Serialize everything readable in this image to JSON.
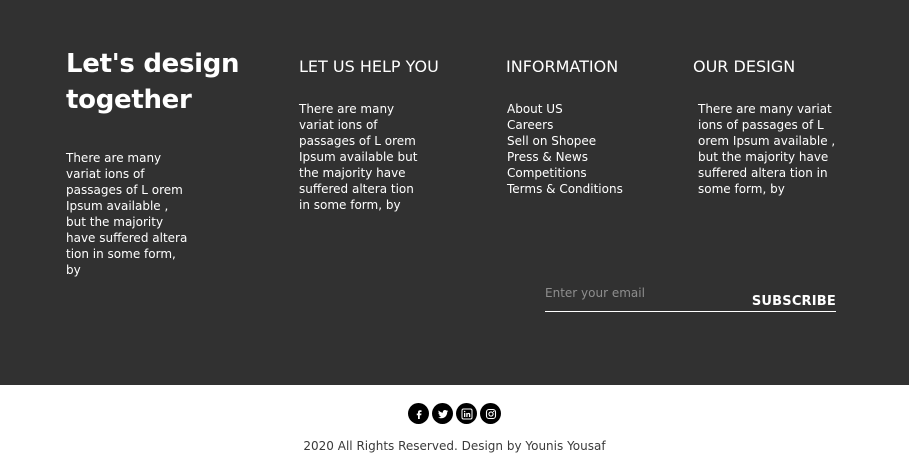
{
  "brand": {
    "title": "Let's design together",
    "text": "There are many variat ions of passages of L orem Ipsum available , but the majority have suffered altera tion in some form, by"
  },
  "help": {
    "heading": "LET US HELP YOU",
    "text": "There are many variat ions of passages of L orem Ipsum available but the majority have suffered altera tion in some form, by"
  },
  "information": {
    "heading": "INFORMATION",
    "links": [
      "About US",
      "Careers",
      "Sell on Shopee",
      "Press & News",
      "Competitions",
      "Terms & Conditions"
    ]
  },
  "design": {
    "heading": "OUR DESIGN",
    "text": "There are many variat ions of passages of L orem Ipsum available , but the majority have suffered altera tion in some form, by"
  },
  "subscribe": {
    "placeholder": "Enter your email",
    "button_label": "SUBSCRIBE"
  },
  "socials": [
    "facebook-icon",
    "twitter-icon",
    "linkedin-icon",
    "instagram-icon"
  ],
  "copyright": "2020 All Rights Reserved. Design by Younis Yousaf",
  "colors": {
    "dark_bg": "#313131",
    "light_bg": "#ffffff",
    "text_light": "#ffffff",
    "text_dark": "#3a3a3a"
  }
}
